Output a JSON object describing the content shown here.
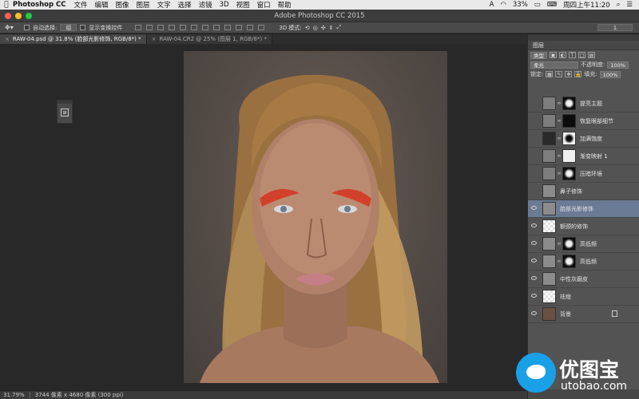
{
  "menubar": {
    "app_name": "Photoshop CC",
    "menus": [
      "文件",
      "编辑",
      "图像",
      "图层",
      "文字",
      "选择",
      "滤镜",
      "3D",
      "视图",
      "窗口",
      "帮助"
    ],
    "battery": "33%",
    "clock": "周四上午11:20"
  },
  "titlebar": {
    "title": "Adobe Photoshop CC 2015"
  },
  "options_bar": {
    "auto_select_label": "自动选择:",
    "auto_select_value": "组",
    "show_transform_label": "显示变换控件",
    "mode_3d_label": "3D 模式:",
    "workspace_value": "1"
  },
  "tabs": [
    {
      "label": "RAW-04.psd @ 31.8% (脸部光影修饰, RGB/8*) *",
      "active": true
    },
    {
      "label": "RAW-04.CR2 @ 25% (图层 1, RGB/8*) *",
      "active": false
    }
  ],
  "status": {
    "zoom": "31.79%",
    "doc_size": "3744 像素 x 4680 像素 (300 ppi)"
  },
  "layers_panel": {
    "tab_label": "图层",
    "filter_label": "类型",
    "blend_mode": "柔光",
    "opacity_label": "不透明度:",
    "opacity_value": "100%",
    "lock_label": "锁定:",
    "fill_label": "填充:",
    "fill_value": "100%",
    "layers": [
      {
        "name": "提亮主题",
        "visible": false,
        "thumb": "adjust",
        "mask": "black-white",
        "selected": false
      },
      {
        "name": "恢复眼部细节",
        "visible": false,
        "thumb": "adjust",
        "mask": "black",
        "selected": false
      },
      {
        "name": "加满饱度",
        "visible": false,
        "thumb": "dark",
        "mask": "white-black",
        "selected": false
      },
      {
        "name": "渐变映射 1",
        "visible": false,
        "thumb": "adjust",
        "mask": "white",
        "selected": false
      },
      {
        "name": "压暗环境",
        "visible": false,
        "thumb": "adjust",
        "mask": "black-white",
        "selected": false
      },
      {
        "name": "鼻子修饰",
        "visible": false,
        "thumb": "gray",
        "mask": "",
        "selected": false
      },
      {
        "name": "脸部光影修饰",
        "visible": true,
        "thumb": "gray",
        "mask": "",
        "selected": true
      },
      {
        "name": "额颈的修饰",
        "visible": true,
        "thumb": "checker",
        "mask": "",
        "selected": false
      },
      {
        "name": "高低频",
        "visible": true,
        "thumb": "gray",
        "mask": "black-white",
        "selected": false
      },
      {
        "name": "高低频",
        "visible": true,
        "thumb": "gray",
        "mask": "black-white",
        "selected": false
      },
      {
        "name": "中性灰磨皮",
        "visible": true,
        "thumb": "gray",
        "mask": "",
        "selected": false
      },
      {
        "name": "祛痘",
        "visible": true,
        "thumb": "checker",
        "mask": "",
        "selected": false
      },
      {
        "name": "背景",
        "visible": true,
        "thumb": "face",
        "mask": "",
        "selected": false,
        "locked": true
      }
    ]
  },
  "watermark": {
    "text_cn": "优图宝",
    "url": "utobao.com"
  },
  "colors": {
    "selected_layer": "#6b7b95",
    "watermark_blue": "#1aa0e6"
  }
}
